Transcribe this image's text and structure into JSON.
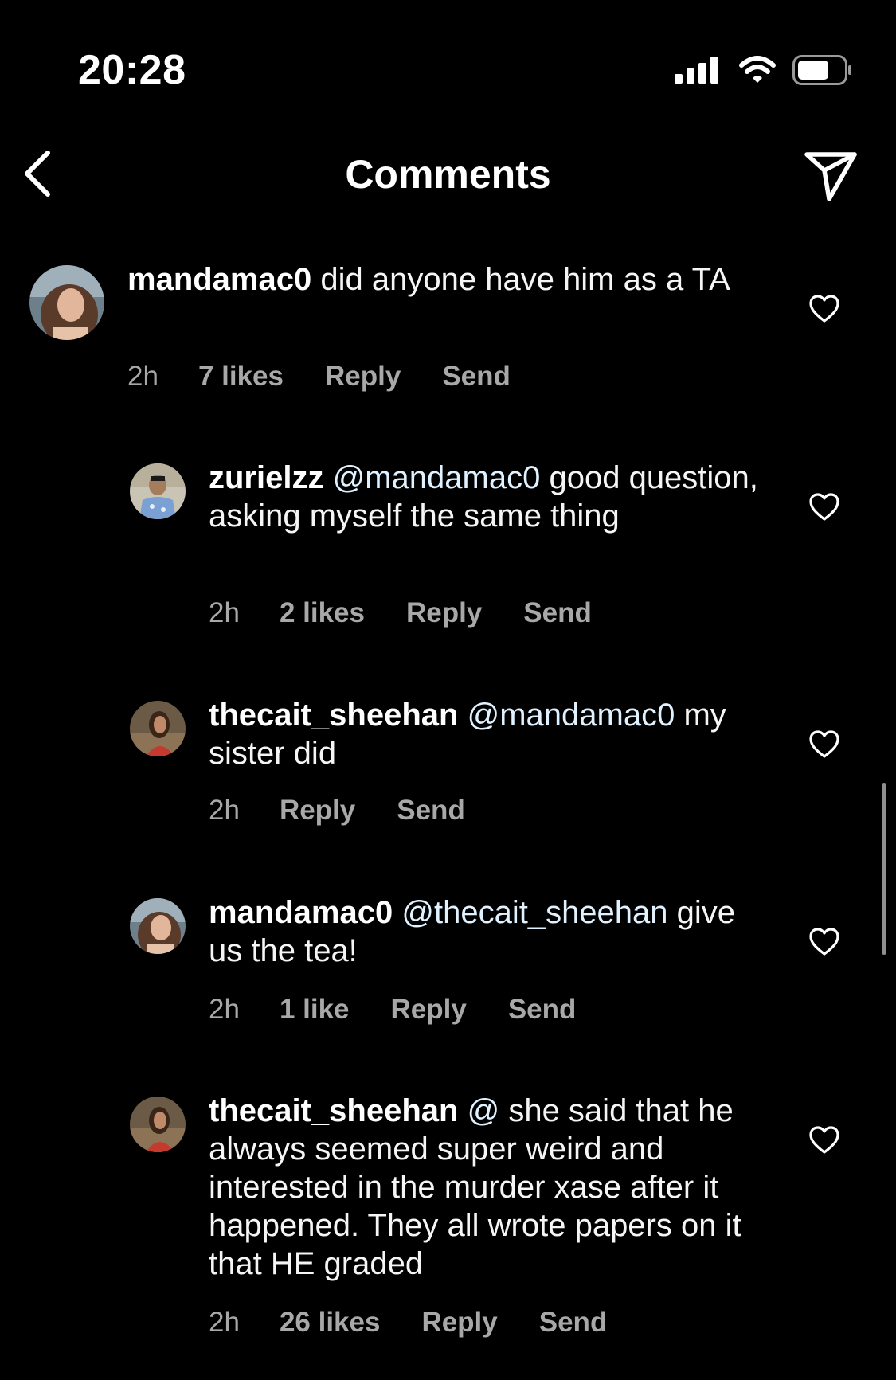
{
  "status_bar": {
    "time": "20:28",
    "icons": [
      "signal-icon",
      "wifi-icon",
      "battery-icon"
    ]
  },
  "header": {
    "title": "Comments",
    "back_icon": "chevron-left-icon",
    "share_icon": "paper-plane-icon"
  },
  "colors": {
    "background": "#000000",
    "text": "#ffffff",
    "meta_text": "#a8a8a8",
    "mention": "#e0f1ff"
  },
  "comments": [
    {
      "username": "mandamac0",
      "mention": "",
      "text": "did anyone have him as a TA",
      "time": "2h",
      "likes": "7 likes",
      "reply_label": "Reply",
      "send_label": "Send"
    },
    {
      "username": "zurielzz",
      "mention": "@mandamac0",
      "text": "good question, asking myself the same thing",
      "time": "2h",
      "likes": "2 likes",
      "reply_label": "Reply",
      "send_label": "Send"
    },
    {
      "username": "thecait_sheehan",
      "mention": "@mandamac0",
      "text": "my sister did",
      "time": "2h",
      "likes": "",
      "reply_label": "Reply",
      "send_label": "Send"
    },
    {
      "username": "mandamac0",
      "mention": "@thecait_sheehan",
      "text": "give us the tea!",
      "time": "2h",
      "likes": "1 like",
      "reply_label": "Reply",
      "send_label": "Send"
    },
    {
      "username": "thecait_sheehan",
      "mention": "@",
      "text": "she said that he always seemed super weird and interested in the murder xase after it happened. They all wrote papers on it that HE graded",
      "time": "2h",
      "likes": "26 likes",
      "reply_label": "Reply",
      "send_label": "Send"
    }
  ]
}
